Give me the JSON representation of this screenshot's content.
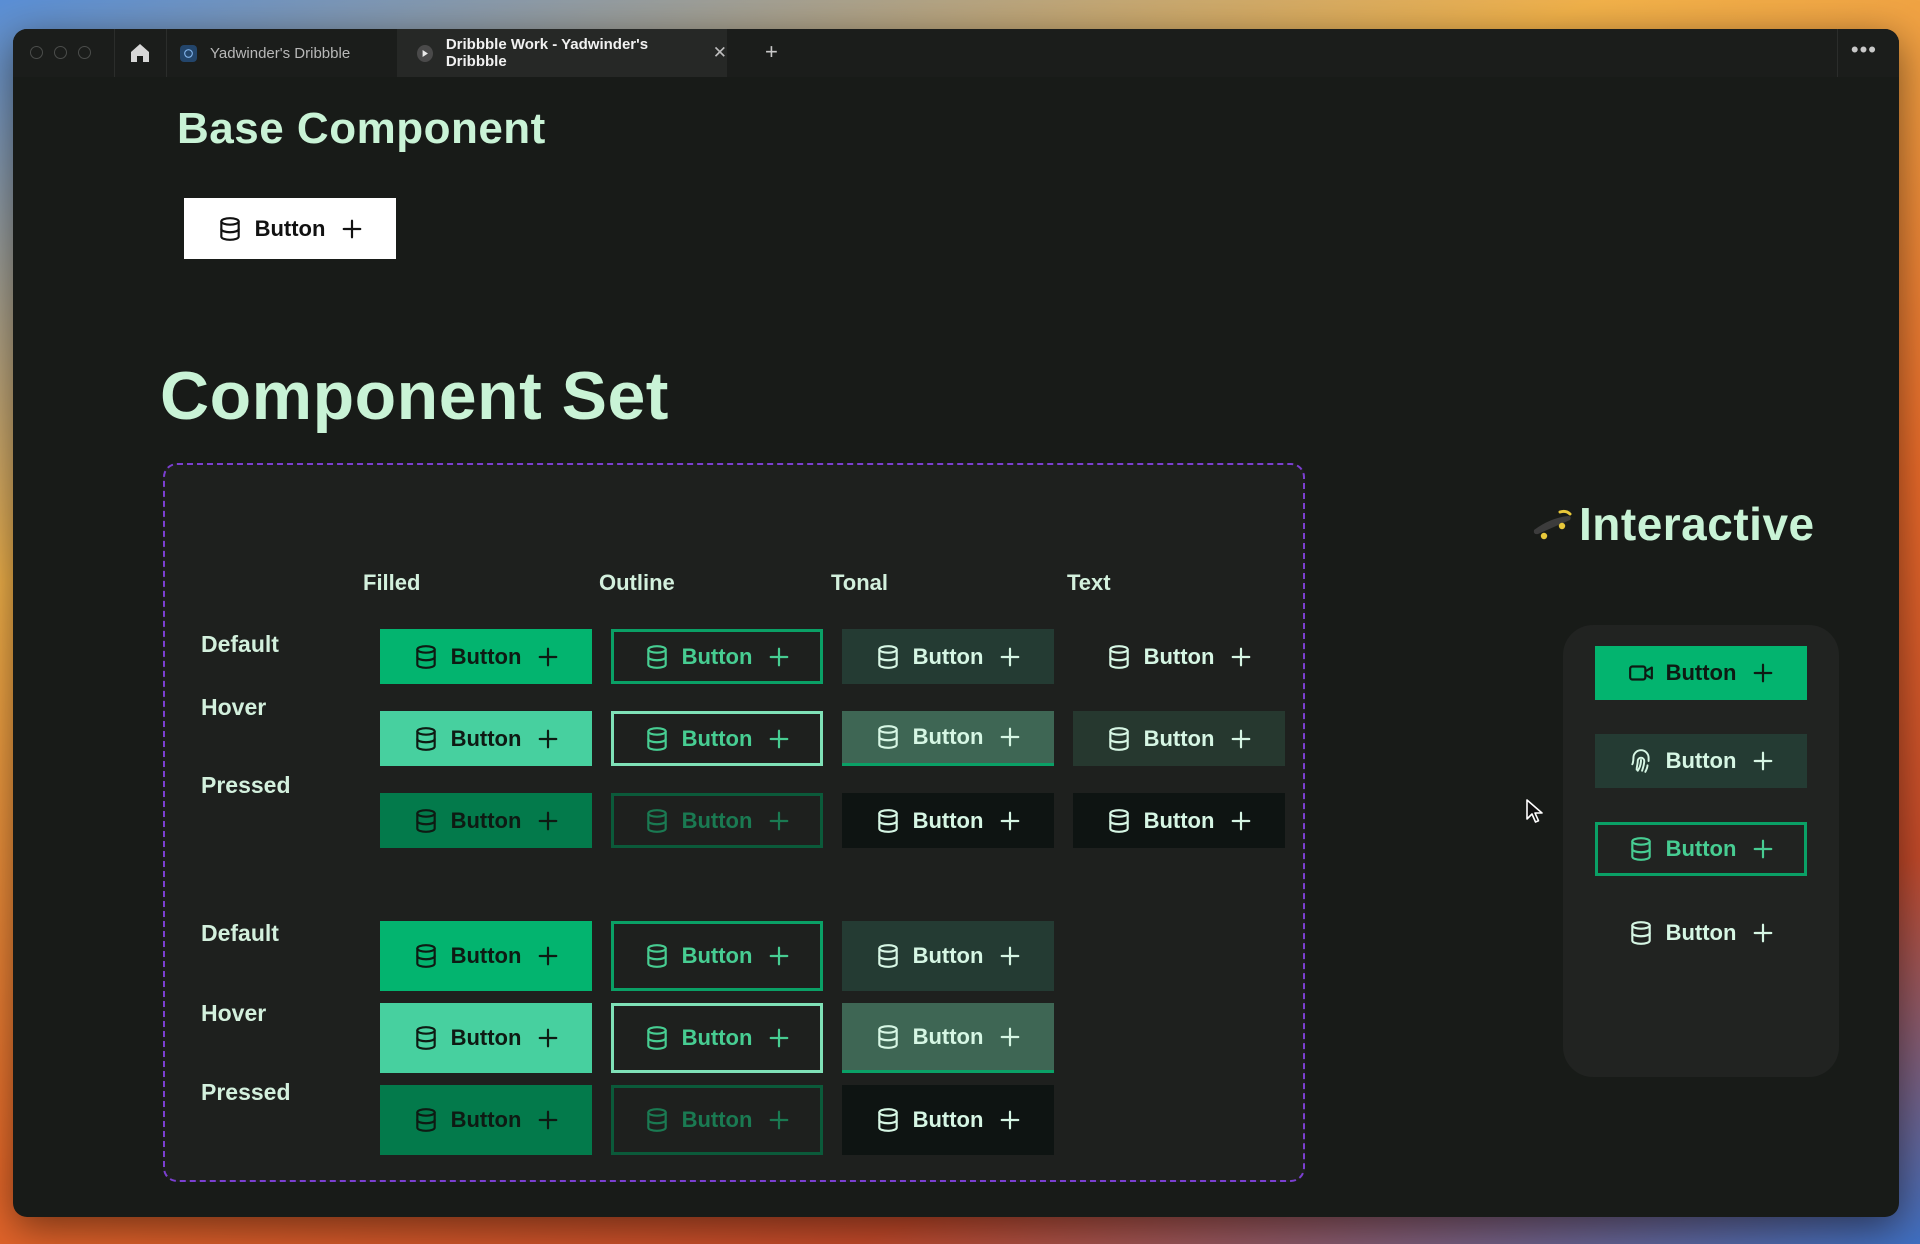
{
  "browser": {
    "tabs": [
      {
        "label": "Yadwinder's Dribbble",
        "active": false
      },
      {
        "label": "Dribbble Work - Yadwinder's Dribbble",
        "active": true
      }
    ]
  },
  "base_component": {
    "title": "Base Component",
    "button": {
      "label": "Button",
      "icon": "database-icon",
      "trailing_icon": "plus-icon"
    }
  },
  "component_set": {
    "title": "Component Set",
    "columns": [
      "Filled",
      "Outline",
      "Tonal",
      "Text"
    ],
    "group1_rows": [
      "Default",
      "Hover",
      "Pressed"
    ],
    "group2_rows": [
      "Default",
      "Hover",
      "Pressed"
    ],
    "button_label": "Button"
  },
  "interactive": {
    "title": "Interactive",
    "buttons": [
      {
        "label": "Button",
        "variant": "filled",
        "icon": "video-icon"
      },
      {
        "label": "Button",
        "variant": "tonal",
        "icon": "fingerprint-icon"
      },
      {
        "label": "Button",
        "variant": "outline",
        "icon": "database-icon"
      },
      {
        "label": "Button",
        "variant": "text",
        "icon": "database-icon"
      }
    ]
  },
  "colors": {
    "heading": "#c9f3d6",
    "filled": "#03b46f",
    "filled_hover": "#47d09f",
    "filled_pressed": "#037a4b",
    "tonal": "#243b33",
    "dashed_border": "#7b3fd1"
  }
}
